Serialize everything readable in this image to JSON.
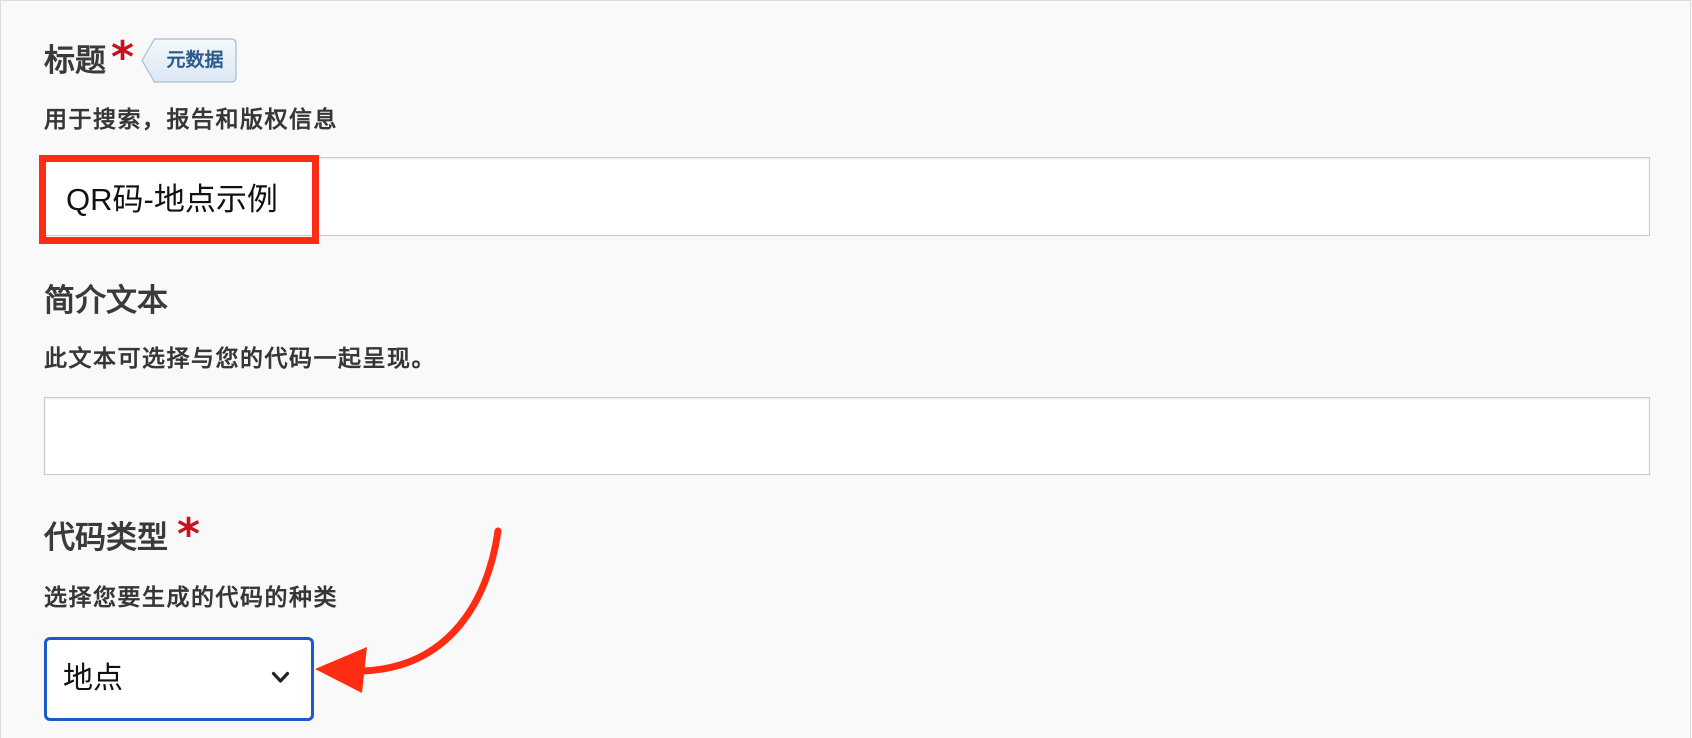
{
  "form": {
    "title_field": {
      "label": "标题",
      "required_mark": "*",
      "tag": "元数据",
      "help": "用于搜索，报告和版权信息",
      "value": "QR码-地点示例"
    },
    "intro_field": {
      "label": "简介文本",
      "help": "此文本可选择与您的代码一起呈现。"
    },
    "code_type_field": {
      "label": "代码类型",
      "required_mark": "*",
      "help": "选择您要生成的代码的种类",
      "selected": "地点"
    }
  },
  "icons": {
    "dropdown": "chevron-down-icon",
    "annotation_arrow": "curved-arrow-icon"
  },
  "colors": {
    "page_bg": "#f9f9f9",
    "label_text": "#3a3a3a",
    "required": "#c8111b",
    "annotation": "#ff2c14",
    "select_border": "#1a5cc7",
    "tag_text": "#2b5a8c",
    "tag_border": "#a6bdd6"
  }
}
